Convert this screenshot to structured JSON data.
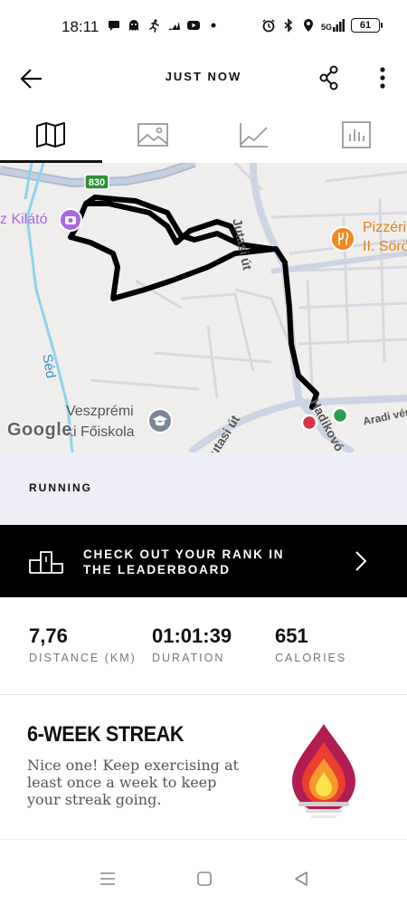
{
  "status_bar": {
    "time": "18:11",
    "battery": "61",
    "network": "5G",
    "left_icons": [
      "chat-bubble-icon",
      "ghost-icon",
      "runner-icon",
      "adidas-icon",
      "youtube-icon",
      "dot-icon"
    ],
    "right_icons": [
      "alarm-icon",
      "bluetooth-icon",
      "location-icon",
      "signal-icon",
      "battery-icon"
    ]
  },
  "header": {
    "title": "JUST NOW",
    "back_icon": "arrow-left-icon",
    "share_icon": "share-icon",
    "more_icon": "more-vertical-icon"
  },
  "tabs": [
    {
      "icon": "map-icon",
      "active": true
    },
    {
      "icon": "image-icon",
      "active": false
    },
    {
      "icon": "line-chart-icon",
      "active": false
    },
    {
      "icon": "bar-chart-icon",
      "active": false
    }
  ],
  "map": {
    "road_number": "830",
    "labels": {
      "kilato": "z Kilátó",
      "pizzeria_line1": "Pizzéri",
      "pizzeria_line2": "II. Sörö",
      "jutasi": "Jutasi út",
      "sed": "Séd",
      "veszpremi_line1": "Veszprémi",
      "veszpremi_line2": "ki Főiskola",
      "jutasi_bottom": "utasi út",
      "hadikovo": "Hadikovó",
      "aradi": "Aradi vér"
    },
    "google": "Google",
    "colors": {
      "route": "#111111",
      "start": "#2e9c4f",
      "end": "#d6334a",
      "poi_purple": "#a868e6",
      "poi_orange": "#f08a24",
      "water": "#8fd3ec"
    }
  },
  "activity": {
    "type": "RUNNING"
  },
  "leaderboard": {
    "text": "CHECK OUT YOUR RANK IN THE LEADERBOARD",
    "icon": "podium-icon",
    "chevron": "chevron-right-icon"
  },
  "stats": [
    {
      "value": "7,76",
      "label": "DISTANCE (KM)"
    },
    {
      "value": "01:01:39",
      "label": "DURATION"
    },
    {
      "value": "651",
      "label": "CALORIES"
    }
  ],
  "streak": {
    "title": "6-WEEK STREAK",
    "text": "Nice one! Keep exercising at least once a week to keep your streak going.",
    "icon": "flame-torch-icon"
  },
  "navbar": {
    "icons": [
      "menu-icon",
      "home-square-icon",
      "back-triangle-icon"
    ]
  }
}
